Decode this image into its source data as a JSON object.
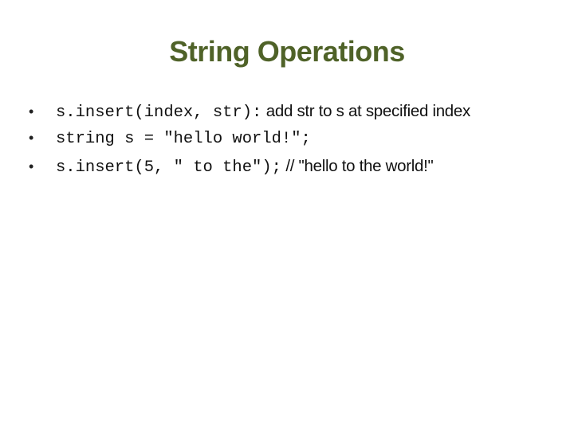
{
  "slide": {
    "title": "String Operations",
    "title_color": "#4f6228",
    "bullets": [
      {
        "code": "s.insert(index, str):",
        "text": " add str to s at specified index"
      },
      {
        "code": "string s = \"hello world!\";",
        "text": ""
      },
      {
        "code": "s.insert(5, \" to the\");",
        "text": " // \"hello to the world!\""
      }
    ]
  }
}
